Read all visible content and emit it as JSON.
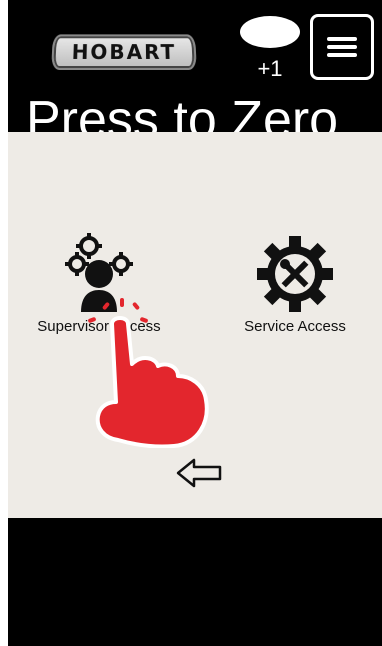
{
  "header": {
    "logo_text": "HOBART",
    "notification_count": "+1",
    "title": "Press to Zero"
  },
  "icons": {
    "menu": "hamburger-icon",
    "supervisor": "supervisor-gears-icon",
    "service": "wrench-screwdriver-gear-icon",
    "back": "left-arrow-icon",
    "hand": "tap-hand-icon"
  },
  "options": {
    "supervisor_label": "Supervisor Access",
    "service_label": "Service Access"
  },
  "colors": {
    "screen_bg": "#000000",
    "panel_bg": "#eeebe6",
    "hand": "#e3262d"
  }
}
